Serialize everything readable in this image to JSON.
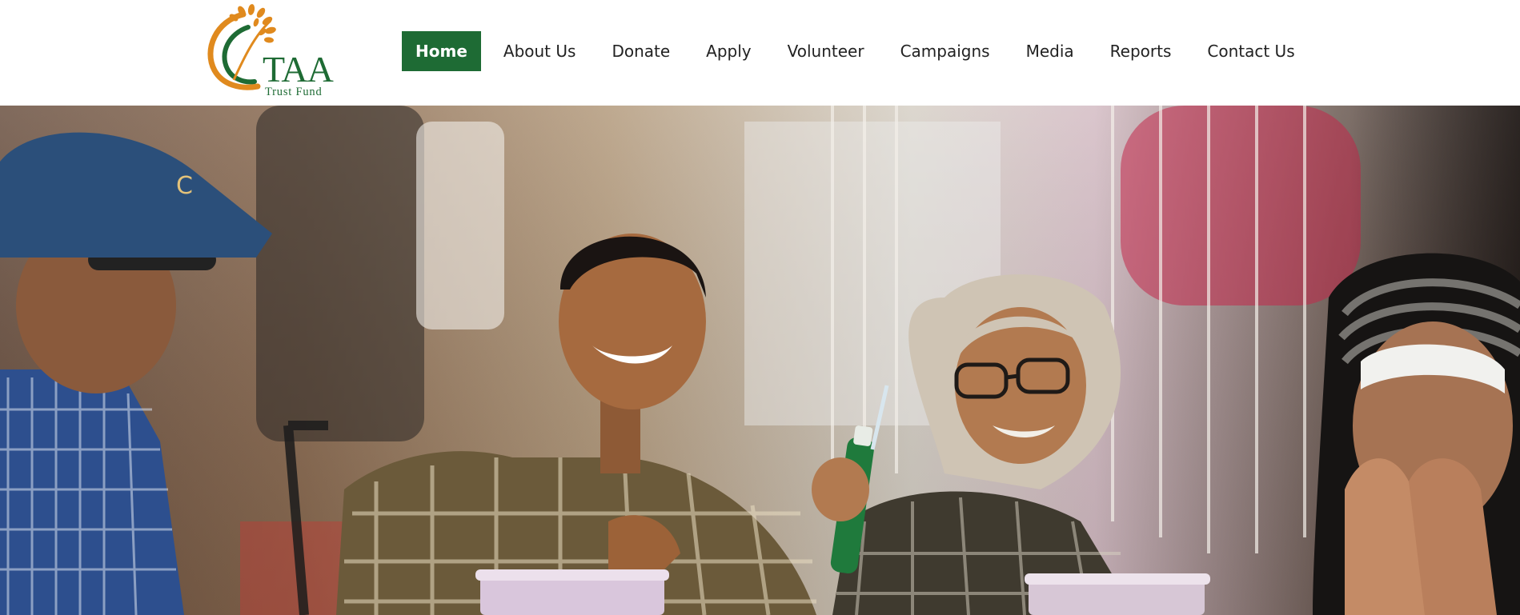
{
  "header": {
    "logo": {
      "icon": "rice-stalk-logo-icon",
      "title": "TAA",
      "subtitle": "Trust Fund"
    },
    "nav": [
      {
        "label": "Home",
        "active": true
      },
      {
        "label": "About Us",
        "active": false
      },
      {
        "label": "Donate",
        "active": false
      },
      {
        "label": "Apply",
        "active": false
      },
      {
        "label": "Volunteer",
        "active": false
      },
      {
        "label": "Campaigns",
        "active": false
      },
      {
        "label": "Media",
        "active": false
      },
      {
        "label": "Reports",
        "active": false
      },
      {
        "label": "Contact Us",
        "active": false
      }
    ]
  },
  "hero": {
    "image": "community-members-photo"
  },
  "colors": {
    "brand_green": "#1e6b34",
    "logo_orange": "#e08a1e",
    "nav_text": "#222222"
  }
}
